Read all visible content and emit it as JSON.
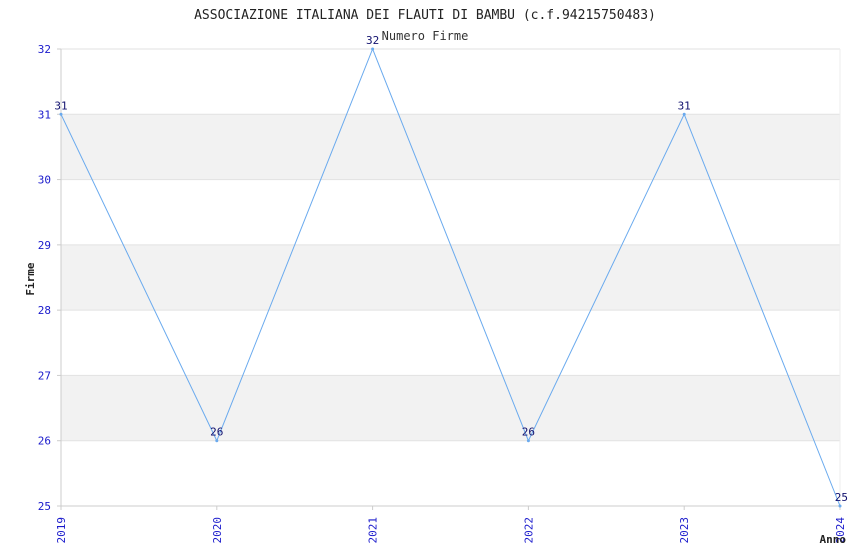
{
  "chart_data": {
    "type": "line",
    "title": "ASSOCIAZIONE ITALIANA DEI FLAUTI DI BAMBU (c.f.94215750483)",
    "legend": "Numero Firme",
    "xlabel": "Anno",
    "ylabel": "Firme",
    "x": [
      "2019",
      "2020",
      "2021",
      "2022",
      "2023",
      "2024"
    ],
    "series": [
      {
        "name": "Numero Firme",
        "values": [
          31,
          26,
          32,
          26,
          31,
          25
        ]
      }
    ],
    "ylim": [
      25,
      32
    ],
    "yticks": [
      25,
      26,
      27,
      28,
      29,
      30,
      31,
      32
    ],
    "grid": "horizontal bands",
    "line_color": "#6aaaee",
    "band_color": "#f2f2f2",
    "tick_color": "#1a1acc"
  }
}
